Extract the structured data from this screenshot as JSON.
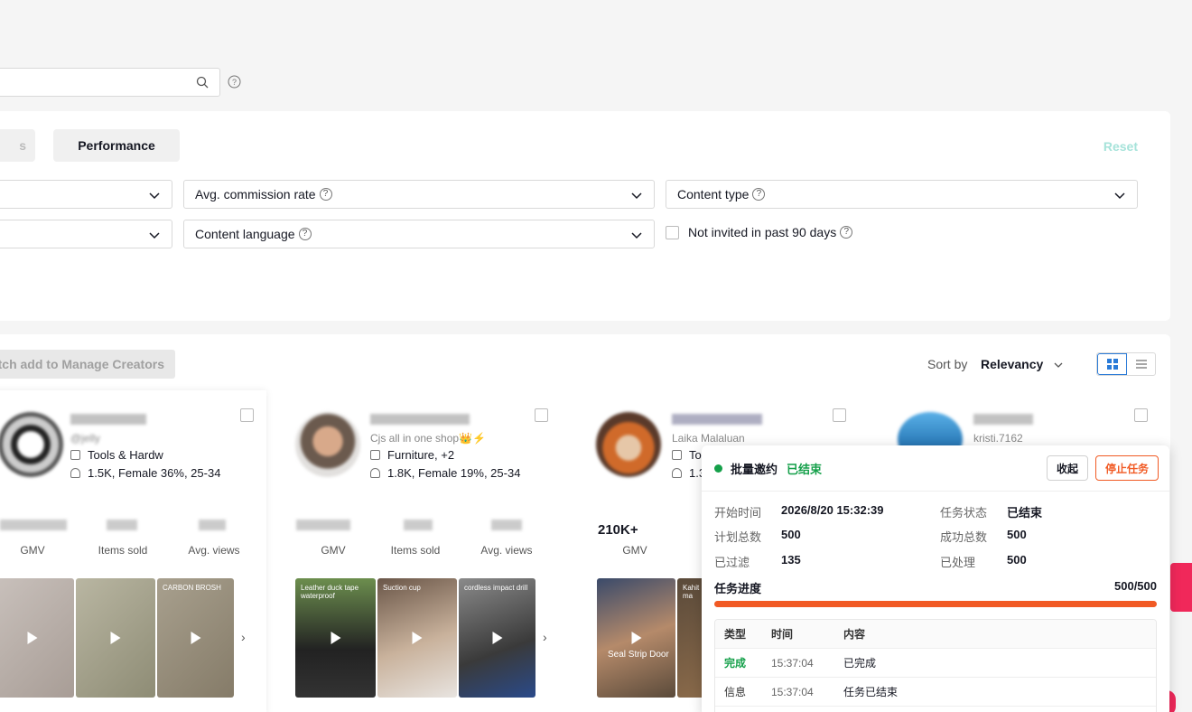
{
  "search": {
    "placeholder": ""
  },
  "filters": {
    "tabs": [
      {
        "label": "s"
      },
      {
        "label": "Performance"
      }
    ],
    "reset_label": "Reset",
    "dropdowns": [
      {
        "label": ""
      },
      {
        "label": "Avg. commission rate"
      },
      {
        "label": "Content type"
      },
      {
        "label": ""
      },
      {
        "label": "Content language"
      }
    ],
    "checkbox_label": "Not invited in past 90 days"
  },
  "results": {
    "batch_add_label": "tch add to Manage Creators",
    "sort_by_label": "Sort by",
    "sort_value": "Relevancy",
    "stat_labels": {
      "gmv": "GMV",
      "items_sold": "Items sold",
      "avg_views": "Avg. views"
    },
    "cards": [
      {
        "name": "",
        "handle": "@jelly",
        "category": "Tools & Hardw",
        "audience": "1.5K, Female 36%, 25-34",
        "gmv": "",
        "items_sold": "",
        "avg_views": "",
        "thumbs": [
          {
            "caption": ""
          },
          {
            "caption": ""
          },
          {
            "caption": "CARBON BROSH"
          }
        ]
      },
      {
        "name": "",
        "handle": "Cjs all in one shop👑⚡",
        "category": "Furniture, +2",
        "audience": "1.8K, Female 19%, 25-34",
        "gmv": "",
        "items_sold": "",
        "avg_views": "",
        "thumbs": [
          {
            "caption": "Leather duck tape waterproof"
          },
          {
            "caption": "Suction cup"
          },
          {
            "caption": "cordless impact drill"
          }
        ]
      },
      {
        "name": "",
        "handle": "Laika Malaluan",
        "category": "To",
        "audience": "1.3",
        "gmv": "210K+",
        "thumbs": [
          {
            "caption": "Seal Strip Door"
          },
          {
            "caption": "Kahit ma"
          }
        ]
      },
      {
        "name": "",
        "handle": "kristi.7162"
      }
    ]
  },
  "task_popup": {
    "title": "批量邀约",
    "status": "已结束",
    "collapse_label": "收起",
    "stop_label": "停止任务",
    "fields": [
      {
        "key": "开始时间",
        "value": "2026/8/20 15:32:39"
      },
      {
        "key": "任务状态",
        "value": "已结束"
      },
      {
        "key": "计划总数",
        "value": "500"
      },
      {
        "key": "成功总数",
        "value": "500"
      },
      {
        "key": "已过滤",
        "value": "135"
      },
      {
        "key": "已处理",
        "value": "500"
      }
    ],
    "progress_label": "任务进度",
    "progress_text": "500/500",
    "progress_fraction": 1.0,
    "log_headers": {
      "type": "类型",
      "time": "时间",
      "content": "内容"
    },
    "log_rows": [
      {
        "type": "完成",
        "time": "15:37:04",
        "content": "已完成",
        "type_color": "#15a04a"
      },
      {
        "type": "信息",
        "time": "15:37:04",
        "content": "任务已结束",
        "type_color": "#333333"
      }
    ]
  },
  "colors": {
    "accent": "#f15a24",
    "success": "#15a04a",
    "brand_pink": "#f0285a",
    "reset_teal": "#a6e3da"
  }
}
